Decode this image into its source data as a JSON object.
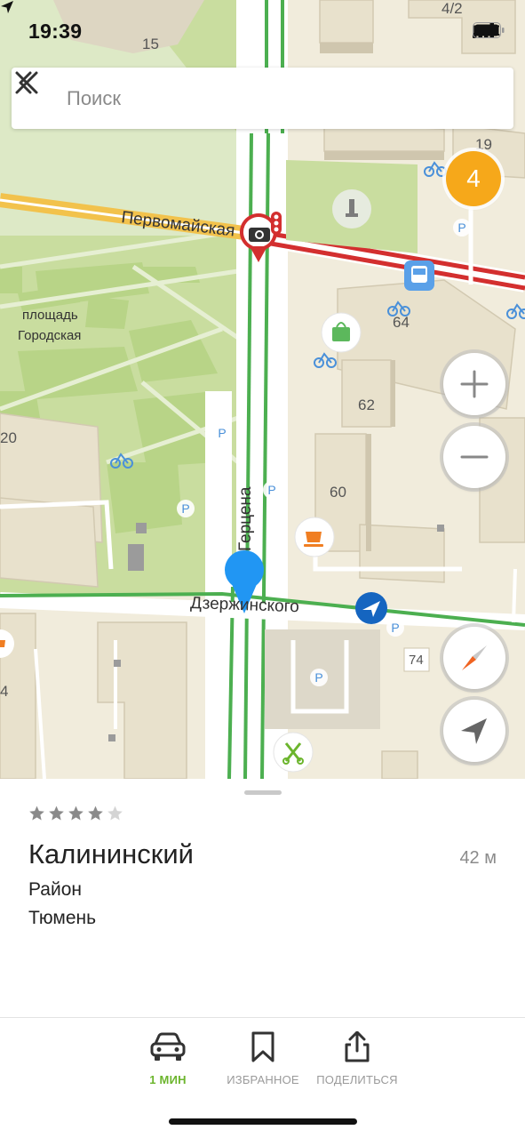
{
  "status_bar": {
    "time": "19:39",
    "network": "LTE"
  },
  "search": {
    "placeholder": "Поиск"
  },
  "map": {
    "streets": {
      "pervomayskaya": "Первомайская",
      "gertsena": "Герцена",
      "dzerzhinskogo": "Дзержинского"
    },
    "areas": {
      "square_line1": "площадь",
      "square_line2": "Городская"
    },
    "house_numbers": {
      "h15": "15",
      "h4_2": "4/2",
      "h19": "19",
      "h64": "64",
      "h62": "62",
      "h60": "60",
      "h20": "20",
      "h74": "74",
      "h4": "4"
    },
    "cluster_count": "4",
    "parking_label": "P",
    "colors": {
      "traffic_free": "#4caf50",
      "traffic_jam": "#d32f2f",
      "main_road": "#f2c24c",
      "park": "#c6dc9d",
      "building": "#e7e0cc",
      "marker": "#2196f3",
      "cluster": "#f6a81a"
    }
  },
  "place": {
    "rating_stars": 4,
    "rating_max": 5,
    "title": "Калининский",
    "distance": "42 м",
    "type": "Район",
    "city": "Тюмень"
  },
  "actions": {
    "route": {
      "label": "1 МИН",
      "icon": "car-icon"
    },
    "favorites": {
      "label": "ИЗБРАННОЕ",
      "icon": "bookmark-icon"
    },
    "share": {
      "label": "ПОДЕЛИТЬСЯ",
      "icon": "share-icon"
    }
  }
}
